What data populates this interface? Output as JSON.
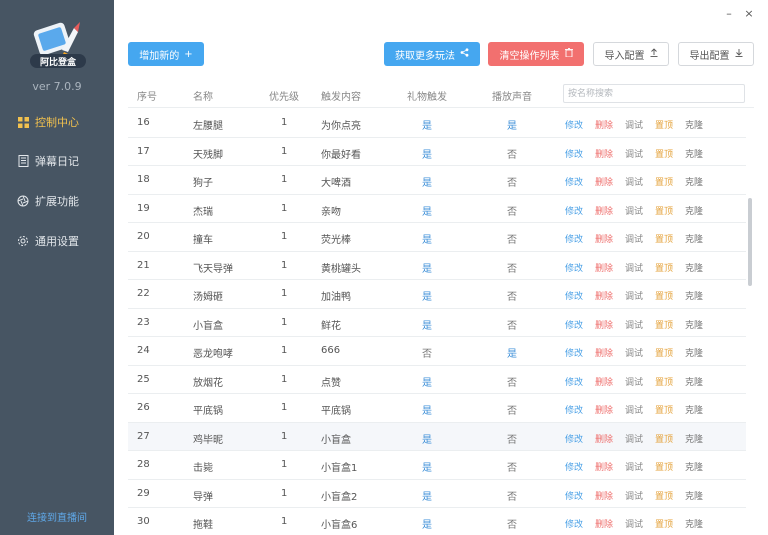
{
  "app": {
    "logo_text": "阿比登盒",
    "version": "ver 7.0.9"
  },
  "sidebar": {
    "items": [
      {
        "label": "控制中心",
        "icon": "grid-icon",
        "active": true
      },
      {
        "label": "弹幕日记",
        "icon": "notebook-icon",
        "active": false
      },
      {
        "label": "扩展功能",
        "icon": "aperture-icon",
        "active": false
      },
      {
        "label": "通用设置",
        "icon": "gear-icon",
        "active": false
      }
    ],
    "connect_label": "连接到直播间"
  },
  "window": {
    "minimize": "–",
    "close": "×"
  },
  "toolbar": {
    "add_label": "增加新的",
    "more_label": "获取更多玩法",
    "clear_label": "清空操作列表",
    "import_label": "导入配置",
    "export_label": "导出配置"
  },
  "table": {
    "headers": [
      "序号",
      "名称",
      "优先级",
      "触发内容",
      "礼物触发",
      "播放声音"
    ],
    "search_placeholder": "按名称搜索",
    "actions": [
      "修改",
      "删除",
      "调试",
      "置顶",
      "克隆"
    ],
    "rows": [
      {
        "id": "16",
        "name": "左腰腿",
        "priority": "1",
        "trigger": "为你点亮",
        "gift": "是",
        "sound": "是"
      },
      {
        "id": "17",
        "name": "天残脚",
        "priority": "1",
        "trigger": "你最好看",
        "gift": "是",
        "sound": "否"
      },
      {
        "id": "18",
        "name": "狗子",
        "priority": "1",
        "trigger": "大啤酒",
        "gift": "是",
        "sound": "否"
      },
      {
        "id": "19",
        "name": "杰瑞",
        "priority": "1",
        "trigger": "亲吻",
        "gift": "是",
        "sound": "否"
      },
      {
        "id": "20",
        "name": "撞车",
        "priority": "1",
        "trigger": "荧光棒",
        "gift": "是",
        "sound": "否"
      },
      {
        "id": "21",
        "name": "飞天导弹",
        "priority": "1",
        "trigger": "黄桃罐头",
        "gift": "是",
        "sound": "否"
      },
      {
        "id": "22",
        "name": "汤姆砸",
        "priority": "1",
        "trigger": "加油鸭",
        "gift": "是",
        "sound": "否"
      },
      {
        "id": "23",
        "name": "小盲盒",
        "priority": "1",
        "trigger": "鲜花",
        "gift": "是",
        "sound": "否"
      },
      {
        "id": "24",
        "name": "恶龙咆哮",
        "priority": "1",
        "trigger": "666",
        "gift": "否",
        "sound": "是"
      },
      {
        "id": "25",
        "name": "放烟花",
        "priority": "1",
        "trigger": "点赞",
        "gift": "是",
        "sound": "否"
      },
      {
        "id": "26",
        "name": "平底锅",
        "priority": "1",
        "trigger": "平底锅",
        "gift": "是",
        "sound": "否"
      },
      {
        "id": "27",
        "name": "鸡毕昵",
        "priority": "1",
        "trigger": "小盲盒",
        "gift": "是",
        "sound": "否"
      },
      {
        "id": "28",
        "name": "击毙",
        "priority": "1",
        "trigger": "小盲盒1",
        "gift": "是",
        "sound": "否"
      },
      {
        "id": "29",
        "name": "导弹",
        "priority": "1",
        "trigger": "小盲盒2",
        "gift": "是",
        "sound": "否"
      },
      {
        "id": "30",
        "name": "拖鞋",
        "priority": "1",
        "trigger": "小盲盒6",
        "gift": "是",
        "sound": "否"
      }
    ]
  },
  "colors": {
    "sidebar_bg": "#475563",
    "accent_blue": "#45a7f0",
    "danger_red": "#f2706f",
    "active_yellow": "#f2c14e"
  }
}
